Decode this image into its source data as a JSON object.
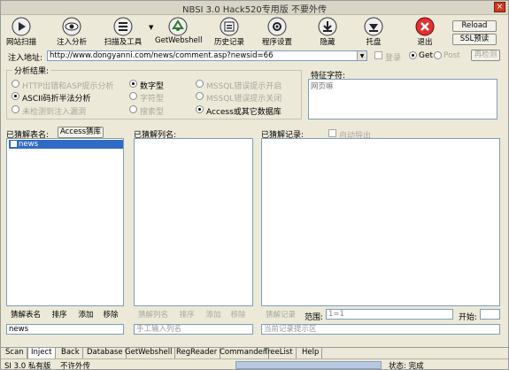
{
  "window": {
    "title": "NBSI 3.0 Hack520专用版  不要外传"
  },
  "toolbar": {
    "tools": [
      {
        "label": "网站扫描",
        "icon": "scan-icon",
        "color": "#3a8a5a"
      },
      {
        "label": "注入分析",
        "icon": "eye-icon",
        "color": "#3a7a8a"
      },
      {
        "label": "扫描及工具",
        "icon": "menu-list-icon",
        "color": "#3a6a7a"
      },
      {
        "label": "GetWebshell",
        "icon": "recycle-icon",
        "color": "#4a9a4a"
      },
      {
        "label": "历史记录",
        "icon": "history-icon",
        "color": "#6a6a6a"
      },
      {
        "label": "程序设置",
        "icon": "settings-icon",
        "color": "#4a7a9a"
      },
      {
        "label": "隐藏",
        "icon": "download-icon",
        "color": "#3a8a4a"
      },
      {
        "label": "托盘",
        "icon": "tray-icon",
        "color": "#3a8a6a"
      },
      {
        "label": "退出",
        "icon": "exit-icon",
        "color": "#c83a2a"
      }
    ],
    "reload_label": "Reload",
    "ssl_label": "SSL预读"
  },
  "address": {
    "label": "注入地址:",
    "url": "http://www.dongyanni.com/news/comment.asp?newsid=66",
    "login_label": "登录",
    "get_label": "Get",
    "post_label": "Post",
    "recheck_label": "再检测"
  },
  "analysis": {
    "group_label": "分析结果:",
    "options_left": [
      "HTTP出错和ASP提示分析",
      "ASCII码折半法分析",
      "未检测到注入漏洞"
    ],
    "options_mid": [
      "数字型",
      "字符型",
      "搜索型"
    ],
    "options_right": [
      "MSSQL错误提示开启",
      "MSSQL错误提示关闭",
      "Access或其它数据库"
    ],
    "feature_label": "特征字符:",
    "feature_value": "网页嘛"
  },
  "panels": {
    "tables_label": "已猜解表名:",
    "access_label": "Access猜库",
    "columns_label": "已猜解列名:",
    "records_label": "已猜解记录:",
    "auto_export_label": "自动导出",
    "table_items": [
      "news"
    ]
  },
  "actions": {
    "tables": [
      "猜解表名",
      "排序",
      "添加",
      "移除"
    ],
    "columns": [
      "猜解列名",
      "排序",
      "添加",
      "移除"
    ],
    "records_btn": "猜解记录",
    "range_label": "范围:",
    "range_value": "1=1",
    "start_label": "开始:",
    "start_value": ""
  },
  "inputs": {
    "table_input": "news",
    "column_input": "手工输入列名",
    "record_input": "当前记录提示区"
  },
  "tabs": [
    "Scan",
    "Inject",
    "Back",
    "Database",
    "GetWebshell",
    "RegReader",
    "Commander",
    "TreeList",
    "Help"
  ],
  "status": {
    "left": "SI 3.0 私有版",
    "left2": "不许外传",
    "right": "状态: 完成"
  }
}
